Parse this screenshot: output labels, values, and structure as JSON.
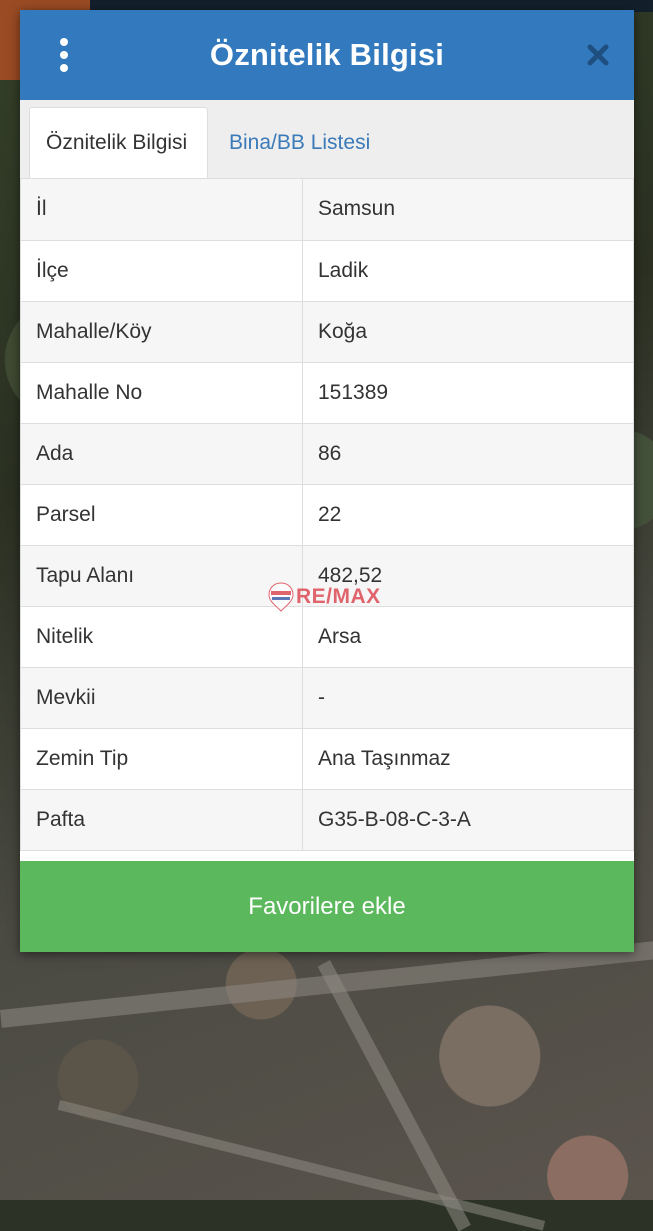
{
  "header": {
    "title": "Öznitelik Bilgisi"
  },
  "tabs": [
    {
      "label": "Öznitelik Bilgisi",
      "active": true
    },
    {
      "label": "Bina/BB Listesi",
      "active": false
    }
  ],
  "attributes": [
    {
      "key": "İl",
      "value": "Samsun"
    },
    {
      "key": "İlçe",
      "value": "Ladik"
    },
    {
      "key": "Mahalle/Köy",
      "value": "Koğa"
    },
    {
      "key": "Mahalle No",
      "value": "151389"
    },
    {
      "key": "Ada",
      "value": "86"
    },
    {
      "key": "Parsel",
      "value": "22"
    },
    {
      "key": "Tapu Alanı",
      "value": "482,52"
    },
    {
      "key": "Nitelik",
      "value": "Arsa"
    },
    {
      "key": "Mevkii",
      "value": "-"
    },
    {
      "key": "Zemin Tip",
      "value": "Ana Taşınmaz"
    },
    {
      "key": "Pafta",
      "value": "G35-B-08-C-3-A"
    }
  ],
  "favorite_button": {
    "label": "Favorilere ekle"
  },
  "watermark": {
    "text": "RE/MAX"
  },
  "colors": {
    "header": "#3279bd",
    "tab_link": "#3a7ab8",
    "favorite_button": "#5cb85c"
  }
}
